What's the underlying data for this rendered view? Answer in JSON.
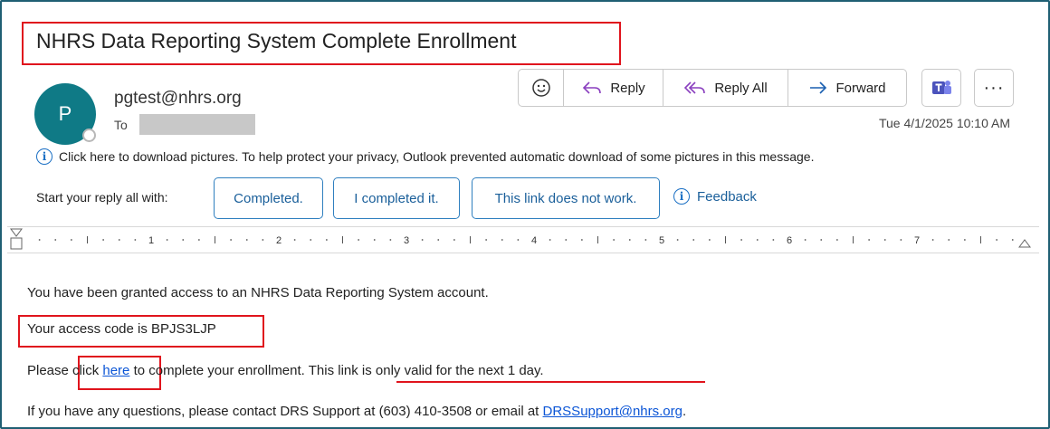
{
  "email": {
    "subject": "NHRS Data Reporting System Complete Enrollment",
    "sender_initial": "P",
    "sender": "pgtest@nhrs.org",
    "to_label": "To",
    "date": "Tue 4/1/2025 10:10 AM"
  },
  "actions": {
    "reply": "Reply",
    "reply_all": "Reply All",
    "forward": "Forward",
    "more": "···"
  },
  "info_bar": {
    "text": "Click here to download pictures. To help protect your privacy, Outlook prevented automatic download of some pictures in this message."
  },
  "suggested_replies": {
    "label": "Start your reply all with:",
    "options": [
      "Completed.",
      "I completed it.",
      "This link does not work."
    ],
    "feedback": "Feedback"
  },
  "ruler": {
    "numbers": [
      "1",
      "2",
      "3",
      "4",
      "5",
      "6",
      "7"
    ]
  },
  "body": {
    "line1": "You have been granted access to an NHRS Data Reporting System account.",
    "line2": "Your access code is BPJS3LJP",
    "line3_before": "Please click ",
    "line3_link": "here",
    "line3_middle": " to complete your enrollment. ",
    "line3_after": "This link is only valid for the next 1 day.",
    "line4_before": "If you have any questions, please contact DRS Support at (603) 410-3508 or email at ",
    "line4_link": "DRSSupport@nhrs.org",
    "line4_after": "."
  },
  "colors": {
    "highlight": "#e0141d",
    "avatar": "#0f7a86",
    "link": "#0b55d6",
    "accent": "#2f7fbf"
  }
}
